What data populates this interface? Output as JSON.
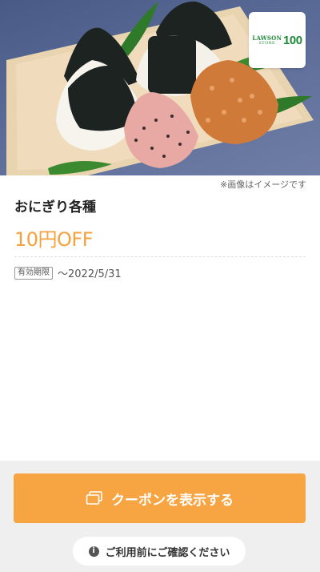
{
  "hero": {
    "image_icon": "rice-balls-photo",
    "logo": {
      "brand_line1": "LAWSON",
      "brand_line2": "STORE",
      "brand_number": "100",
      "color": "#1f8a3a"
    }
  },
  "image_note": "※画像はイメージです",
  "product": {
    "title": "おにぎり各種",
    "discount": "10円OFF",
    "discount_color": "#f5a13c"
  },
  "expiry": {
    "label": "有効期限",
    "value": "〜2022/5/31"
  },
  "actions": {
    "show_coupon_label": "クーポンを表示する",
    "show_coupon_icon": "coupon-copy-icon",
    "button_color": "#f7a442",
    "confirm_label": "ご利用前にご確認ください",
    "confirm_icon": "info-icon"
  }
}
